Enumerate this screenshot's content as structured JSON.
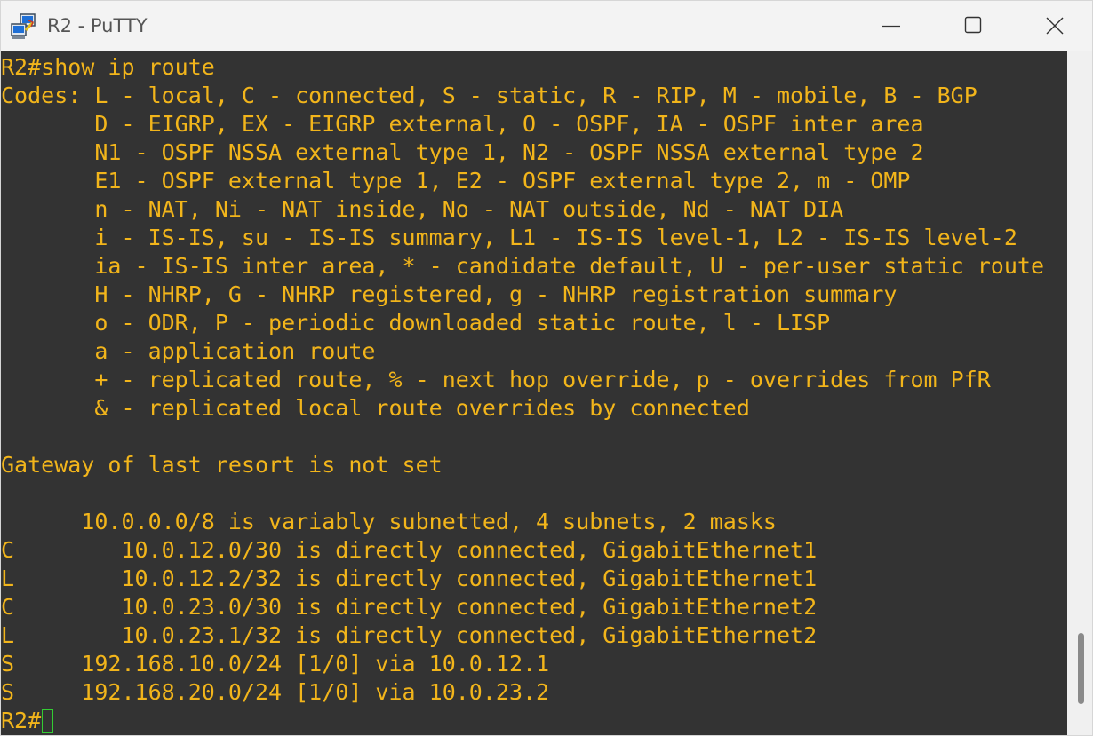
{
  "window": {
    "title": "R2 - PuTTY",
    "icon": "putty-icon",
    "controls": [
      "minimize-icon",
      "maximize-icon",
      "close-icon"
    ]
  },
  "terminal": {
    "colors": {
      "background": "#333333",
      "foreground": "#f2b51b",
      "cursor": "#33cc33"
    },
    "lines": [
      "R2#show ip route",
      "Codes: L - local, C - connected, S - static, R - RIP, M - mobile, B - BGP",
      "       D - EIGRP, EX - EIGRP external, O - OSPF, IA - OSPF inter area",
      "       N1 - OSPF NSSA external type 1, N2 - OSPF NSSA external type 2",
      "       E1 - OSPF external type 1, E2 - OSPF external type 2, m - OMP",
      "       n - NAT, Ni - NAT inside, No - NAT outside, Nd - NAT DIA",
      "       i - IS-IS, su - IS-IS summary, L1 - IS-IS level-1, L2 - IS-IS level-2",
      "       ia - IS-IS inter area, * - candidate default, U - per-user static route",
      "       H - NHRP, G - NHRP registered, g - NHRP registration summary",
      "       o - ODR, P - periodic downloaded static route, l - LISP",
      "       a - application route",
      "       + - replicated route, % - next hop override, p - overrides from PfR",
      "       & - replicated local route overrides by connected",
      "",
      "Gateway of last resort is not set",
      "",
      "      10.0.0.0/8 is variably subnetted, 4 subnets, 2 masks",
      "C        10.0.12.0/30 is directly connected, GigabitEthernet1",
      "L        10.0.12.2/32 is directly connected, GigabitEthernet1",
      "C        10.0.23.0/30 is directly connected, GigabitEthernet2",
      "L        10.0.23.1/32 is directly connected, GigabitEthernet2",
      "S     192.168.10.0/24 [1/0] via 10.0.12.1",
      "S     192.168.20.0/24 [1/0] via 10.0.23.2"
    ],
    "prompt": "R2#"
  }
}
